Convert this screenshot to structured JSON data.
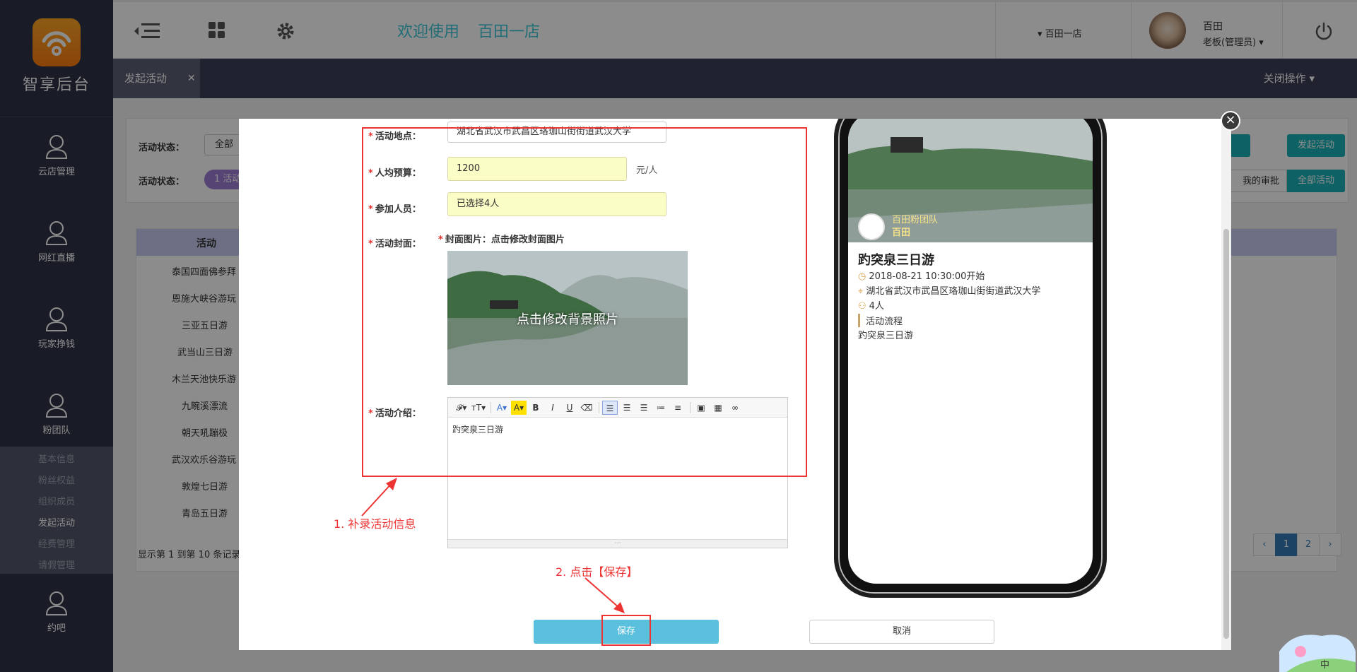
{
  "sidebar": {
    "logo_text": "智享后台",
    "nav": [
      {
        "label": "云店管理"
      },
      {
        "label": "网红直播"
      },
      {
        "label": "玩家挣钱"
      },
      {
        "label": "粉团队"
      }
    ],
    "sub": [
      "基本信息",
      "粉丝权益",
      "组织成员",
      "发起活动",
      "经费管理",
      "请假管理"
    ],
    "bottom_nav": {
      "label": "约吧"
    }
  },
  "topbar": {
    "welcome": "欢迎使用",
    "shop": "百田一店",
    "shop_select": "百田一店",
    "user_name": "百田",
    "user_role": "老板(管理员)"
  },
  "tabs": {
    "active": "发起活动",
    "close_ops": "关闭操作"
  },
  "background": {
    "filter_label_1": "活动状态：",
    "filter_label_2": "活动状态：",
    "filter_value_1": "全部",
    "filter_pill": "1 活动",
    "btn_start": "发起活动",
    "btn_mine": "我的审批",
    "btn_all": "全部活动",
    "table_header": "活动",
    "rows": [
      "泰国四面佛参拜",
      "恩施大峡谷游玩",
      "三亚五日游",
      "武当山三日游",
      "木兰天池快乐游",
      "九畹溪漂流",
      "朝天吼蹦极",
      "武汉欢乐谷游玩",
      "敦煌七日游",
      "青岛五日游"
    ],
    "page_info": "显示第 1 到第 10 条记录",
    "pages": [
      "‹",
      "1",
      "2",
      "›"
    ]
  },
  "form": {
    "location_label": "活动地点：",
    "location_value": "湖北省武汉市武昌区珞珈山街街道武汉大学",
    "budget_label": "人均预算：",
    "budget_value": "1200",
    "budget_unit": "元/人",
    "members_label": "参加人员：",
    "members_value": "已选择4人",
    "cover_label": "活动封面：",
    "cover_hint": "封面图片：点击修改封面图片",
    "cover_overlay": "点击修改背景照片",
    "intro_label": "活动介绍：",
    "intro_text": "趵突泉三日游",
    "save": "保存",
    "cancel": "取消"
  },
  "annotations": {
    "step1": "1. 补录活动信息",
    "step2": "2. 点击【保存】"
  },
  "phone": {
    "team_name": "百田粉团队",
    "leader": "百田",
    "title": "趵突泉三日游",
    "time": "2018-08-21 10:30:00开始",
    "address": "湖北省武汉市武昌区珞珈山街街道武汉大学",
    "people": "4人",
    "flow_label": "活动流程",
    "flow_text": "趵突泉三日游"
  },
  "mascot_text": "中",
  "colors": {
    "sidebar": "#2e3346",
    "accent": "#3ec6d8",
    "teal": "#1ab3b8",
    "save": "#5bc0de",
    "annotation": "#ee3333"
  }
}
